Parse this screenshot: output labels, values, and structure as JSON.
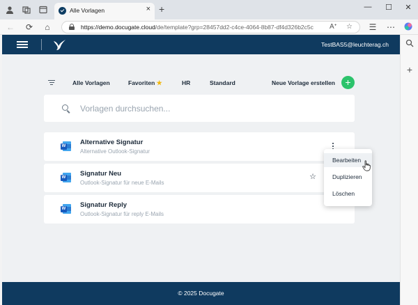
{
  "browser": {
    "tab_title": "Alle Vorlagen",
    "url_host": "https://demo.docugate.cloud",
    "url_path": "/de/template?grp=28457dd2-c4ce-4064-8b87-df4d326b2c5c"
  },
  "header": {
    "user": "TestBAS5@leuchterag.ch"
  },
  "filters": {
    "items": [
      "Alle Vorlagen",
      "Favoriten",
      "HR",
      "Standard"
    ],
    "create_label": "Neue Vorlage erstellen"
  },
  "search": {
    "placeholder": "Vorlagen durchsuchen..."
  },
  "templates": [
    {
      "name": "Alternative Signatur",
      "description": "Alternative Outlook-Signatur"
    },
    {
      "name": "Signatur Neu",
      "description": "Outlook-Signatur für neue E-Mails"
    },
    {
      "name": "Signatur Reply",
      "description": "Outlook-Signatur für reply E-Mails"
    }
  ],
  "context_menu": {
    "items": [
      "Bearbeiten",
      "Duplizieren",
      "Löschen"
    ],
    "hovered": "Bearbeiten"
  },
  "footer": {
    "text": "© 2025 Docugate"
  },
  "colors": {
    "brand_navy": "#0f3a5f",
    "accent_green": "#2cc36b",
    "favorite_star": "#f2b70a"
  }
}
